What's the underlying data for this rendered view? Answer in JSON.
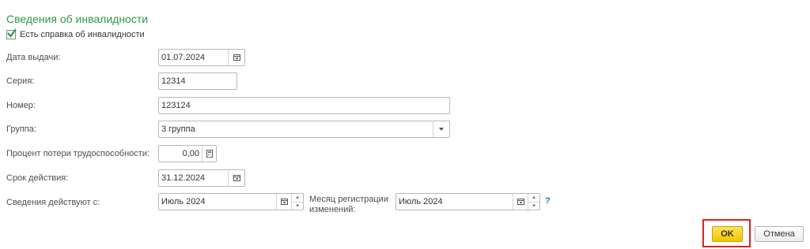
{
  "section_title": "Сведения об инвалидности",
  "has_certificate": {
    "label": "Есть справка об инвалидности",
    "checked": true
  },
  "fields": {
    "issue_date": {
      "label": "Дата выдачи:",
      "value": "01.07.2024"
    },
    "series": {
      "label": "Серия:",
      "value": "12314"
    },
    "number": {
      "label": "Номер:",
      "value": "123124"
    },
    "group": {
      "label": "Группа:",
      "value": "3 группа"
    },
    "disability_percent": {
      "label": "Процент потери трудоспособности:",
      "value": "0,00"
    },
    "valid_until": {
      "label": "Срок действия:",
      "value": "31.12.2024"
    },
    "effective_from": {
      "label": "Сведения действуют с:",
      "value": "Июль 2024"
    },
    "registration_month": {
      "label_line1": "Месяц регистрации",
      "label_line2": "изменений:",
      "value": "Июль 2024"
    }
  },
  "help_mark": "?",
  "buttons": {
    "ok": "OK",
    "cancel": "Отмена"
  },
  "colors": {
    "title": "#2e9a47",
    "ok_button": "#f5c400",
    "highlight": "#e02020",
    "help": "#1a73c8"
  }
}
